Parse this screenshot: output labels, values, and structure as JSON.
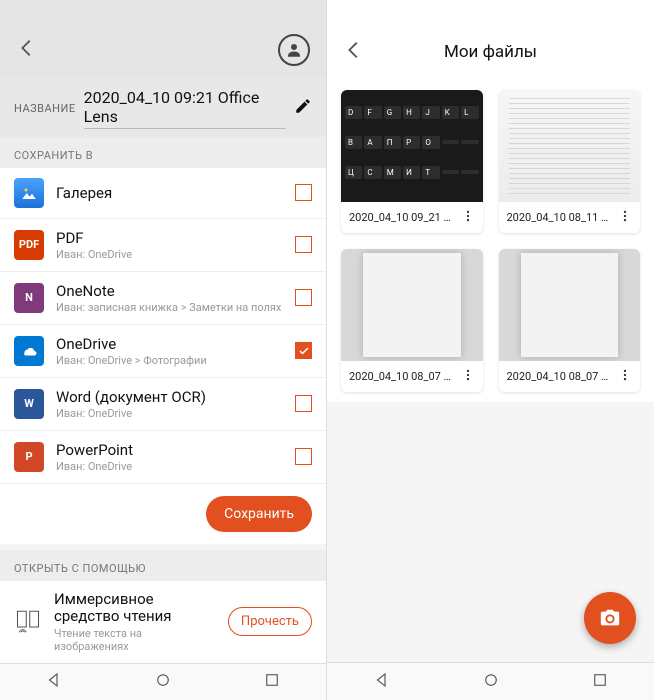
{
  "left": {
    "title_label": "НАЗВАНИЕ",
    "title_value": "2020_04_10 09:21 Office Lens",
    "save_in_label": "СОХРАНИТЬ В",
    "rows": [
      {
        "name": "Галерея",
        "sub": "",
        "checked": false
      },
      {
        "name": "PDF",
        "sub": "Иван: OneDrive",
        "checked": false
      },
      {
        "name": "OneNote",
        "sub": "Иван: записная книжка > Заметки на полях",
        "checked": false
      },
      {
        "name": "OneDrive",
        "sub": "Иван: OneDrive > Фотографии",
        "checked": true
      },
      {
        "name": "Word (документ OCR)",
        "sub": "Иван: OneDrive",
        "checked": false
      },
      {
        "name": "PowerPoint",
        "sub": "Иван: OneDrive",
        "checked": false
      }
    ],
    "save_btn": "Сохранить",
    "open_with_label": "ОТКРЫТЬ С ПОМОЩЬЮ",
    "reader_name": "Иммерсивное средство чтения",
    "reader_sub": "Чтение текста на изображениях",
    "read_btn": "Прочесть"
  },
  "right": {
    "title": "Мои файлы",
    "files": [
      {
        "name": "2020_04_10 09_21 …",
        "thumb": "kb"
      },
      {
        "name": "2020_04_10 08_11 …",
        "thumb": "doc"
      },
      {
        "name": "2020_04_10 08_07 …",
        "thumb": "page"
      },
      {
        "name": "2020_04_10 08_07 …",
        "thumb": "page"
      }
    ]
  },
  "icons": {
    "row_glyphs": [
      "",
      "PDF",
      "N",
      "",
      "W",
      "P"
    ]
  }
}
